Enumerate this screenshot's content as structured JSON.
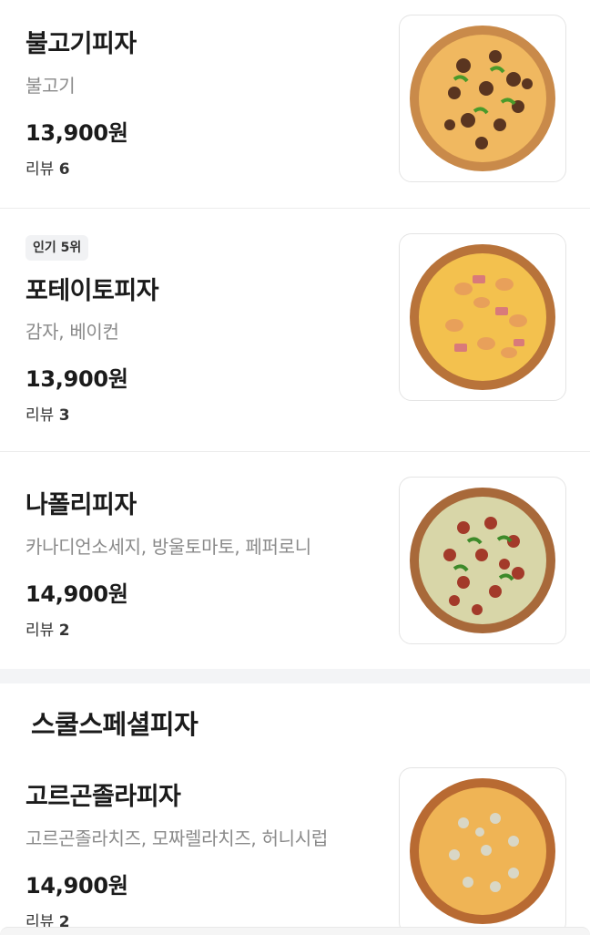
{
  "menu_items": [
    {
      "name": "불고기피자",
      "description": "불고기",
      "price": "13,900원",
      "review_label": "리뷰",
      "review_count": "6",
      "badge": "",
      "thumb_icon": "bulgogi-pizza-image"
    },
    {
      "name": "포테이토피자",
      "description": "감자, 베이컨",
      "price": "13,900원",
      "review_label": "리뷰",
      "review_count": "3",
      "badge": "인기 5위",
      "thumb_icon": "potato-pizza-image"
    },
    {
      "name": "나폴리피자",
      "description": "카나디언소세지, 방울토마토, 페퍼로니",
      "price": "14,900원",
      "review_label": "리뷰",
      "review_count": "2",
      "badge": "",
      "thumb_icon": "napoli-pizza-image"
    }
  ],
  "section": {
    "title": "스쿨스페셜피자"
  },
  "section_items": [
    {
      "name": "고르곤졸라피자",
      "description": "고르곤졸라치즈, 모짜렐라치즈, 허니시럽",
      "price": "14,900원",
      "review_label": "리뷰",
      "review_count": "2",
      "thumb_icon": "gorgonzola-pizza-image"
    }
  ]
}
